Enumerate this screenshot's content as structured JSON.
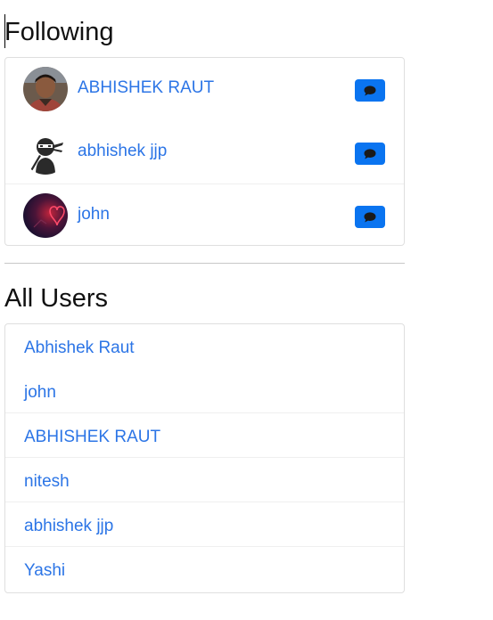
{
  "following": {
    "title": "Following",
    "users": [
      {
        "name": "ABHISHEK RAUT",
        "avatar": "profile-photo"
      },
      {
        "name": "abhishek jjp",
        "avatar": "ninja-avatar"
      },
      {
        "name": "john",
        "avatar": "red-heart-avatar"
      }
    ],
    "chat_icon": "chat-bubble-icon"
  },
  "all_users": {
    "title": "All Users",
    "users": [
      "Abhishek Raut",
      "john",
      "ABHISHEK RAUT",
      "nitesh",
      "abhishek jjp",
      "Yashi"
    ]
  },
  "colors": {
    "link": "#2c75e6",
    "chat_button": "#0a74f0"
  }
}
